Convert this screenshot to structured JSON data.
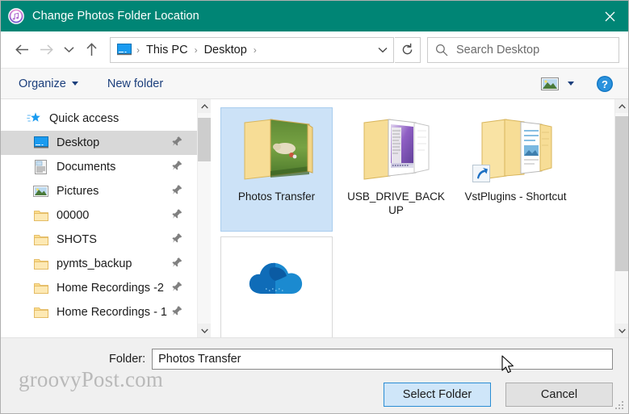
{
  "window": {
    "title": "Change Photos Folder Location",
    "icon": "itunes-note-icon",
    "close_label": "✕",
    "titlebar_color": "#008575"
  },
  "nav": {
    "back": "back-arrow",
    "forward": "forward-arrow",
    "recent": "recent-locations-chevron",
    "up": "up-arrow",
    "breadcrumb": {
      "icon": "this-pc-monitor-icon",
      "items": [
        "This PC",
        "Desktop"
      ],
      "separator": "›",
      "trailing_separator": "›"
    },
    "dropdown": "chevron-down-icon",
    "refresh": "refresh-icon",
    "search": {
      "placeholder": "Search Desktop",
      "icon": "search-icon",
      "value": ""
    }
  },
  "toolbar": {
    "organize": "Organize",
    "new_folder": "New folder",
    "view_icon": "view-thumbnail-icon",
    "view_dropdown": "chevron-down-icon",
    "help": "?"
  },
  "sidebar": {
    "items": [
      {
        "label": "Quick access",
        "icon": "quick-access-star-icon",
        "level": 0,
        "selected": false,
        "pinned": false
      },
      {
        "label": "Desktop",
        "icon": "desktop-monitor-icon",
        "level": 1,
        "selected": true,
        "pinned": true
      },
      {
        "label": "Documents",
        "icon": "documents-icon",
        "level": 1,
        "selected": false,
        "pinned": true
      },
      {
        "label": "Pictures",
        "icon": "pictures-icon",
        "level": 1,
        "selected": false,
        "pinned": true
      },
      {
        "label": "00000",
        "icon": "folder-icon",
        "level": 1,
        "selected": false,
        "pinned": true
      },
      {
        "label": "SHOTS",
        "icon": "folder-icon",
        "level": 1,
        "selected": false,
        "pinned": true
      },
      {
        "label": "pymts_backup",
        "icon": "folder-icon",
        "level": 1,
        "selected": false,
        "pinned": true
      },
      {
        "label": "Home Recordings -2",
        "icon": "folder-icon",
        "level": 1,
        "selected": false,
        "pinned": true
      },
      {
        "label": "Home Recordings - 1",
        "icon": "folder-icon",
        "level": 1,
        "selected": false,
        "pinned": true
      }
    ]
  },
  "files": {
    "items": [
      {
        "label": "Photos Transfer",
        "type": "folder-photo-thumb",
        "state": "selected",
        "shortcut": false
      },
      {
        "label": "USB_DRIVE_BACKUP",
        "type": "folder-screenshot-thumb",
        "state": "normal",
        "shortcut": false
      },
      {
        "label": "VstPlugins - Shortcut",
        "type": "folder-document-thumb",
        "state": "normal",
        "shortcut": true
      },
      {
        "label": "",
        "type": "onedrive-cloud-icon",
        "state": "hover",
        "shortcut": false
      }
    ]
  },
  "footer": {
    "folder_label": "Folder:",
    "folder_value": "Photos Transfer",
    "select_button": "Select Folder",
    "cancel_button": "Cancel",
    "watermark": "groovyPost.com"
  }
}
